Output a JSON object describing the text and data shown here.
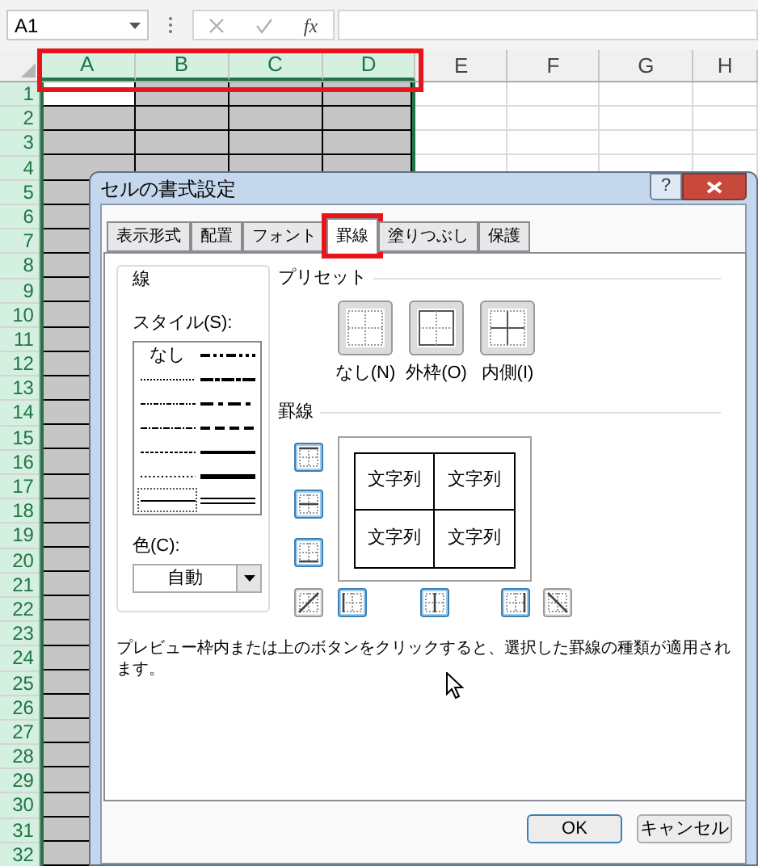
{
  "formula_bar": {
    "name_box": "A1",
    "function_label": "fx"
  },
  "sheet": {
    "columns": [
      {
        "label": "A",
        "selected": true,
        "active": true
      },
      {
        "label": "B",
        "selected": true,
        "active": false
      },
      {
        "label": "C",
        "selected": true,
        "active": false
      },
      {
        "label": "D",
        "selected": true,
        "active": false
      },
      {
        "label": "E",
        "selected": false,
        "active": false
      },
      {
        "label": "F",
        "selected": false,
        "active": false
      },
      {
        "label": "G",
        "selected": false,
        "active": false
      },
      {
        "label": "H",
        "selected": false,
        "active": false
      }
    ],
    "column_headers_highlighted": true,
    "rows": [
      {
        "label": "1",
        "selected": true,
        "active": true
      },
      {
        "label": "2",
        "selected": true,
        "active": false
      },
      {
        "label": "3",
        "selected": true,
        "active": false
      },
      {
        "label": "4",
        "selected": true,
        "active": false
      },
      {
        "label": "5",
        "selected": true,
        "active": false
      },
      {
        "label": "6",
        "selected": true,
        "active": false
      },
      {
        "label": "7",
        "selected": true,
        "active": false
      },
      {
        "label": "8",
        "selected": true,
        "active": false
      },
      {
        "label": "9",
        "selected": true,
        "active": false
      },
      {
        "label": "10",
        "selected": true,
        "active": false
      },
      {
        "label": "11",
        "selected": true,
        "active": false
      },
      {
        "label": "12",
        "selected": true,
        "active": false
      },
      {
        "label": "13",
        "selected": true,
        "active": false
      },
      {
        "label": "14",
        "selected": true,
        "active": false
      },
      {
        "label": "15",
        "selected": true,
        "active": false
      },
      {
        "label": "16",
        "selected": true,
        "active": false
      },
      {
        "label": "17",
        "selected": true,
        "active": false
      },
      {
        "label": "18",
        "selected": true,
        "active": false
      },
      {
        "label": "19",
        "selected": true,
        "active": false
      },
      {
        "label": "20",
        "selected": true,
        "active": false
      },
      {
        "label": "21",
        "selected": true,
        "active": false
      },
      {
        "label": "22",
        "selected": true,
        "active": false
      },
      {
        "label": "23",
        "selected": true,
        "active": false
      },
      {
        "label": "24",
        "selected": true,
        "active": false
      },
      {
        "label": "25",
        "selected": true,
        "active": false
      },
      {
        "label": "26",
        "selected": true,
        "active": false
      },
      {
        "label": "27",
        "selected": true,
        "active": false
      },
      {
        "label": "28",
        "selected": true,
        "active": false
      },
      {
        "label": "29",
        "selected": true,
        "active": false
      },
      {
        "label": "30",
        "selected": true,
        "active": false
      },
      {
        "label": "31",
        "selected": true,
        "active": false
      },
      {
        "label": "32",
        "selected": true,
        "active": false
      }
    ]
  },
  "dialog": {
    "title": "セルの書式設定",
    "help_button": "?",
    "tabs": [
      {
        "label": "表示形式",
        "selected": false,
        "highlighted": false
      },
      {
        "label": "配置",
        "selected": false,
        "highlighted": false
      },
      {
        "label": "フォント",
        "selected": false,
        "highlighted": false
      },
      {
        "label": "罫線",
        "selected": true,
        "highlighted": true
      },
      {
        "label": "塗りつぶし",
        "selected": false,
        "highlighted": false
      },
      {
        "label": "保護",
        "selected": false,
        "highlighted": false
      }
    ],
    "line": {
      "title": "線",
      "style_label": "スタイル(S):",
      "styles": [
        {
          "kind": "none",
          "label": "なし",
          "selected": false
        },
        {
          "kind": "hair",
          "selected": false
        },
        {
          "kind": "dash_dot_dot",
          "selected": false
        },
        {
          "kind": "dash_dot",
          "selected": false
        },
        {
          "kind": "dashed",
          "selected": false
        },
        {
          "kind": "dotted",
          "selected": false
        },
        {
          "kind": "thin",
          "selected": true
        },
        {
          "kind": "medium_dash_dot_dot",
          "selected": false
        },
        {
          "kind": "slant_dash_dot",
          "selected": false
        },
        {
          "kind": "medium_dash_dot",
          "selected": false
        },
        {
          "kind": "medium_dashed",
          "selected": false
        },
        {
          "kind": "medium",
          "selected": false
        },
        {
          "kind": "thick",
          "selected": false
        },
        {
          "kind": "double",
          "selected": false
        }
      ],
      "color_label": "色(C):",
      "color_value": "自動"
    },
    "presets": {
      "title": "プリセット",
      "items": [
        {
          "kind": "none",
          "label": "なし(N)"
        },
        {
          "kind": "outline",
          "label": "外枠(O)"
        },
        {
          "kind": "inside",
          "label": "内側(I)"
        }
      ]
    },
    "border": {
      "title": "罫線",
      "toggles": [
        {
          "kind": "top",
          "on": true
        },
        {
          "kind": "inside_h",
          "on": true
        },
        {
          "kind": "bottom",
          "on": true
        },
        {
          "kind": "diag_up",
          "on": false
        },
        {
          "kind": "left",
          "on": true
        },
        {
          "kind": "inside_v",
          "on": true
        },
        {
          "kind": "right",
          "on": true
        },
        {
          "kind": "diag_down",
          "on": false
        }
      ],
      "preview_cells": [
        "文字列",
        "文字列",
        "文字列",
        "文字列"
      ]
    },
    "hint": "プレビュー枠内または上のボタンをクリックすると、選択した罫線の種類が適用されます。",
    "buttons": [
      {
        "label": "OK",
        "default": true
      },
      {
        "label": "キャンセル",
        "default": false
      }
    ]
  }
}
